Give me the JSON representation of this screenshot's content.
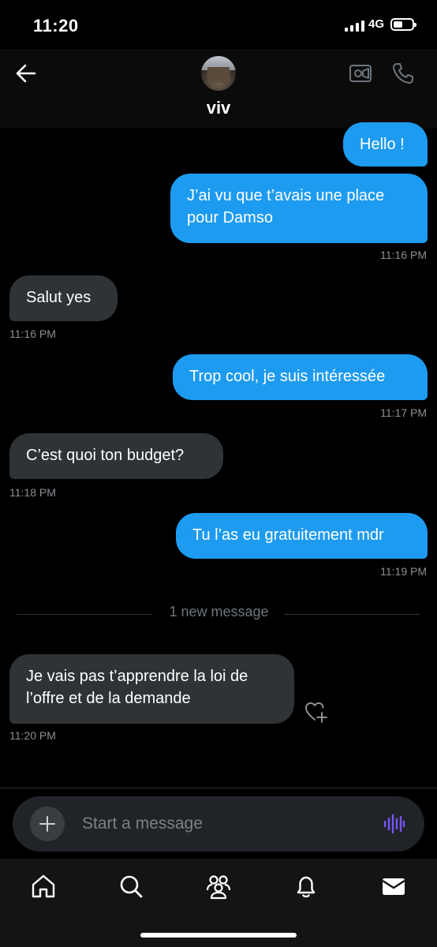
{
  "status_bar": {
    "time": "11:20",
    "network": "4G"
  },
  "header": {
    "contact_name": "viv"
  },
  "messages": [
    {
      "text": "Hello !"
    },
    {
      "text": "J’ai vu que t’avais une place pour Damso",
      "time": "11:16 PM"
    },
    {
      "text": "Salut yes",
      "time": "11:16 PM"
    },
    {
      "text": "Trop cool, je suis intéressée",
      "time": "11:17 PM"
    },
    {
      "text": "C’est quoi ton budget?",
      "time": "11:18 PM"
    },
    {
      "text": "Tu l’as eu gratuitement mdr",
      "time": "11:19 PM"
    },
    {
      "text": "Je vais pas t’apprendre la loi de l’offre et de la demande",
      "time": "11:20 PM"
    }
  ],
  "divider": {
    "label": "1 new message"
  },
  "composer": {
    "placeholder": "Start a message"
  },
  "colors": {
    "accent": "#1d9bf0",
    "incoming": "#2f3336",
    "voice": "#7856ff"
  },
  "icons": [
    "back-arrow-icon",
    "video-call-icon",
    "phone-icon",
    "add-reaction-icon",
    "plus-icon",
    "voice-waveform-icon",
    "home-icon",
    "search-icon",
    "communities-icon",
    "notifications-icon",
    "messages-icon"
  ]
}
